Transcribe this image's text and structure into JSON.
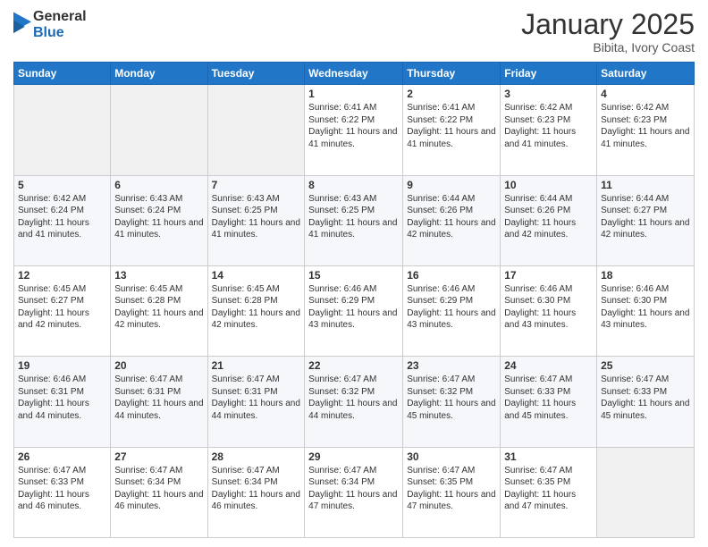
{
  "logo": {
    "general": "General",
    "blue": "Blue"
  },
  "header": {
    "month": "January 2025",
    "location": "Bibita, Ivory Coast"
  },
  "weekdays": [
    "Sunday",
    "Monday",
    "Tuesday",
    "Wednesday",
    "Thursday",
    "Friday",
    "Saturday"
  ],
  "weeks": [
    [
      {
        "day": "",
        "sunrise": "",
        "sunset": "",
        "daylight": ""
      },
      {
        "day": "",
        "sunrise": "",
        "sunset": "",
        "daylight": ""
      },
      {
        "day": "",
        "sunrise": "",
        "sunset": "",
        "daylight": ""
      },
      {
        "day": "1",
        "sunrise": "Sunrise: 6:41 AM",
        "sunset": "Sunset: 6:22 PM",
        "daylight": "Daylight: 11 hours and 41 minutes."
      },
      {
        "day": "2",
        "sunrise": "Sunrise: 6:41 AM",
        "sunset": "Sunset: 6:22 PM",
        "daylight": "Daylight: 11 hours and 41 minutes."
      },
      {
        "day": "3",
        "sunrise": "Sunrise: 6:42 AM",
        "sunset": "Sunset: 6:23 PM",
        "daylight": "Daylight: 11 hours and 41 minutes."
      },
      {
        "day": "4",
        "sunrise": "Sunrise: 6:42 AM",
        "sunset": "Sunset: 6:23 PM",
        "daylight": "Daylight: 11 hours and 41 minutes."
      }
    ],
    [
      {
        "day": "5",
        "sunrise": "Sunrise: 6:42 AM",
        "sunset": "Sunset: 6:24 PM",
        "daylight": "Daylight: 11 hours and 41 minutes."
      },
      {
        "day": "6",
        "sunrise": "Sunrise: 6:43 AM",
        "sunset": "Sunset: 6:24 PM",
        "daylight": "Daylight: 11 hours and 41 minutes."
      },
      {
        "day": "7",
        "sunrise": "Sunrise: 6:43 AM",
        "sunset": "Sunset: 6:25 PM",
        "daylight": "Daylight: 11 hours and 41 minutes."
      },
      {
        "day": "8",
        "sunrise": "Sunrise: 6:43 AM",
        "sunset": "Sunset: 6:25 PM",
        "daylight": "Daylight: 11 hours and 41 minutes."
      },
      {
        "day": "9",
        "sunrise": "Sunrise: 6:44 AM",
        "sunset": "Sunset: 6:26 PM",
        "daylight": "Daylight: 11 hours and 42 minutes."
      },
      {
        "day": "10",
        "sunrise": "Sunrise: 6:44 AM",
        "sunset": "Sunset: 6:26 PM",
        "daylight": "Daylight: 11 hours and 42 minutes."
      },
      {
        "day": "11",
        "sunrise": "Sunrise: 6:44 AM",
        "sunset": "Sunset: 6:27 PM",
        "daylight": "Daylight: 11 hours and 42 minutes."
      }
    ],
    [
      {
        "day": "12",
        "sunrise": "Sunrise: 6:45 AM",
        "sunset": "Sunset: 6:27 PM",
        "daylight": "Daylight: 11 hours and 42 minutes."
      },
      {
        "day": "13",
        "sunrise": "Sunrise: 6:45 AM",
        "sunset": "Sunset: 6:28 PM",
        "daylight": "Daylight: 11 hours and 42 minutes."
      },
      {
        "day": "14",
        "sunrise": "Sunrise: 6:45 AM",
        "sunset": "Sunset: 6:28 PM",
        "daylight": "Daylight: 11 hours and 42 minutes."
      },
      {
        "day": "15",
        "sunrise": "Sunrise: 6:46 AM",
        "sunset": "Sunset: 6:29 PM",
        "daylight": "Daylight: 11 hours and 43 minutes."
      },
      {
        "day": "16",
        "sunrise": "Sunrise: 6:46 AM",
        "sunset": "Sunset: 6:29 PM",
        "daylight": "Daylight: 11 hours and 43 minutes."
      },
      {
        "day": "17",
        "sunrise": "Sunrise: 6:46 AM",
        "sunset": "Sunset: 6:30 PM",
        "daylight": "Daylight: 11 hours and 43 minutes."
      },
      {
        "day": "18",
        "sunrise": "Sunrise: 6:46 AM",
        "sunset": "Sunset: 6:30 PM",
        "daylight": "Daylight: 11 hours and 43 minutes."
      }
    ],
    [
      {
        "day": "19",
        "sunrise": "Sunrise: 6:46 AM",
        "sunset": "Sunset: 6:31 PM",
        "daylight": "Daylight: 11 hours and 44 minutes."
      },
      {
        "day": "20",
        "sunrise": "Sunrise: 6:47 AM",
        "sunset": "Sunset: 6:31 PM",
        "daylight": "Daylight: 11 hours and 44 minutes."
      },
      {
        "day": "21",
        "sunrise": "Sunrise: 6:47 AM",
        "sunset": "Sunset: 6:31 PM",
        "daylight": "Daylight: 11 hours and 44 minutes."
      },
      {
        "day": "22",
        "sunrise": "Sunrise: 6:47 AM",
        "sunset": "Sunset: 6:32 PM",
        "daylight": "Daylight: 11 hours and 44 minutes."
      },
      {
        "day": "23",
        "sunrise": "Sunrise: 6:47 AM",
        "sunset": "Sunset: 6:32 PM",
        "daylight": "Daylight: 11 hours and 45 minutes."
      },
      {
        "day": "24",
        "sunrise": "Sunrise: 6:47 AM",
        "sunset": "Sunset: 6:33 PM",
        "daylight": "Daylight: 11 hours and 45 minutes."
      },
      {
        "day": "25",
        "sunrise": "Sunrise: 6:47 AM",
        "sunset": "Sunset: 6:33 PM",
        "daylight": "Daylight: 11 hours and 45 minutes."
      }
    ],
    [
      {
        "day": "26",
        "sunrise": "Sunrise: 6:47 AM",
        "sunset": "Sunset: 6:33 PM",
        "daylight": "Daylight: 11 hours and 46 minutes."
      },
      {
        "day": "27",
        "sunrise": "Sunrise: 6:47 AM",
        "sunset": "Sunset: 6:34 PM",
        "daylight": "Daylight: 11 hours and 46 minutes."
      },
      {
        "day": "28",
        "sunrise": "Sunrise: 6:47 AM",
        "sunset": "Sunset: 6:34 PM",
        "daylight": "Daylight: 11 hours and 46 minutes."
      },
      {
        "day": "29",
        "sunrise": "Sunrise: 6:47 AM",
        "sunset": "Sunset: 6:34 PM",
        "daylight": "Daylight: 11 hours and 47 minutes."
      },
      {
        "day": "30",
        "sunrise": "Sunrise: 6:47 AM",
        "sunset": "Sunset: 6:35 PM",
        "daylight": "Daylight: 11 hours and 47 minutes."
      },
      {
        "day": "31",
        "sunrise": "Sunrise: 6:47 AM",
        "sunset": "Sunset: 6:35 PM",
        "daylight": "Daylight: 11 hours and 47 minutes."
      },
      {
        "day": "",
        "sunrise": "",
        "sunset": "",
        "daylight": ""
      }
    ]
  ]
}
